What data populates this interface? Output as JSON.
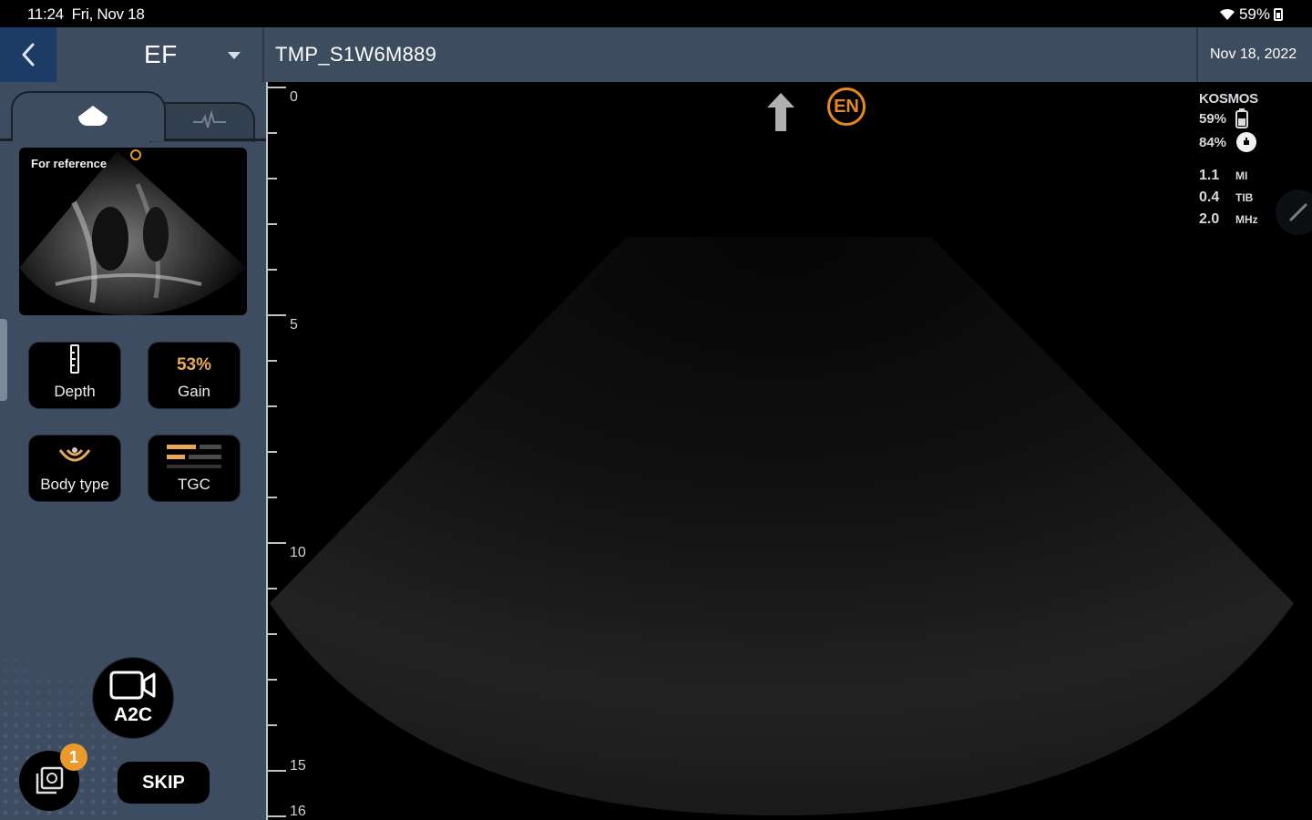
{
  "status_bar": {
    "time": "11:24",
    "date": "Fri, Nov 18",
    "battery": "59%"
  },
  "header": {
    "mode": "EF",
    "patient_id": "TMP_S1W6M889",
    "exam_date": "Nov 18, 2022"
  },
  "left_panel": {
    "tabs": [
      {
        "icon": "image-mode-icon",
        "selected": true
      },
      {
        "icon": "ecg-icon",
        "selected": false
      }
    ],
    "reference_label": "For reference",
    "controls": {
      "depth_label": "Depth",
      "gain_value": "53%",
      "gain_label": "Gain",
      "body_type_label": "Body type",
      "tgc_label": "TGC"
    },
    "record": {
      "icon": "video-camera-icon",
      "label": "A2C"
    },
    "gallery_badge": "1",
    "skip_label": "SKIP"
  },
  "image_area": {
    "depth_labels": [
      "0",
      "5",
      "10",
      "15",
      "16"
    ],
    "logo_text": "EN",
    "device": {
      "name": "KOSMOS",
      "probe_battery": "59%",
      "tablet_battery": "84%",
      "params": [
        {
          "value": "1.1",
          "unit": "MI"
        },
        {
          "value": "0.4",
          "unit": "TIB"
        },
        {
          "value": "2.0",
          "unit": "MHz"
        }
      ]
    }
  },
  "colors": {
    "panel": "#3e4c61",
    "back_button": "#1c3b66",
    "accent_orange": "#e99a2b",
    "gain_text": "#e9a855"
  }
}
